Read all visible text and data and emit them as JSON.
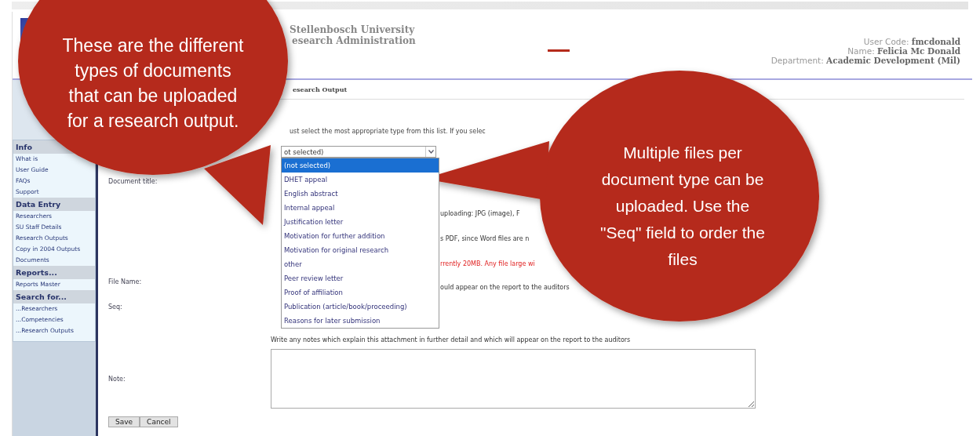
{
  "header": {
    "title": "Stellenbosch University",
    "subtitle": "esearch Administration",
    "user": [
      {
        "label": "User Code:",
        "value": "fmcdonald"
      },
      {
        "label": "Name:",
        "value": "Felicia Mc Donald"
      },
      {
        "label": "Department:",
        "value": "Academic Development (Mil)"
      }
    ]
  },
  "breadcrumb": "esearch Output",
  "sidebar": [
    {
      "title": "Info",
      "items": [
        "What is",
        "User Guide",
        "FAQs",
        "Support"
      ]
    },
    {
      "title": "Data Entry",
      "items": [
        "Researchers",
        "SU Staff Details",
        "Research Outputs",
        "Copy in 2004 Outputs",
        "Documents"
      ]
    },
    {
      "title": "Reports...",
      "items": [
        "Reports Master"
      ]
    },
    {
      "title": "Search for...",
      "items": [
        "...Researchers",
        "...Competencies",
        "...Research Outputs"
      ]
    }
  ],
  "form": {
    "instruction": "ust select the most appropriate type from this list. If you selec",
    "document_type": {
      "value": "ot selected)",
      "expanded": true,
      "options": [
        {
          "label": "(not selected)",
          "selected": true
        },
        {
          "label": "DHET appeal",
          "selected": false
        },
        {
          "label": "English abstract",
          "selected": false
        },
        {
          "label": "Internal appeal",
          "selected": false
        },
        {
          "label": "Justification letter",
          "selected": false
        },
        {
          "label": "Motivation for further addition",
          "selected": false
        },
        {
          "label": "Motivation for original research",
          "selected": false
        },
        {
          "label": "other",
          "selected": false
        },
        {
          "label": "Peer review letter",
          "selected": false
        },
        {
          "label": "Proof of affiliation",
          "selected": false
        },
        {
          "label": "Publication (article/book/proceeding)",
          "selected": false
        },
        {
          "label": "Reasons for later submission",
          "selected": false
        }
      ]
    },
    "document_title": {
      "label": "Document title:",
      "hints": [
        "uploading: JPG (image), F",
        "s PDF, since Word files are n"
      ],
      "warning": "rrently 20MB. Any file large wi"
    },
    "file_name": {
      "label": "File Name:",
      "hint": "ould appear on the report to the auditors"
    },
    "seq": {
      "label": "Seq:"
    },
    "note": {
      "label": "Note:",
      "hint": "Write any notes which explain this attachment in further detail and which will appear on the report to the auditors"
    },
    "buttons": [
      "Save",
      "Cancel"
    ]
  },
  "callouts": [
    {
      "lines": [
        "These are the different",
        "types of documents",
        "that can be uploaded",
        "for a research output."
      ]
    },
    {
      "lines": [
        "Multiple files per",
        "document type can be",
        "uploaded. Use the",
        "\"Seq\" field to order the",
        "files"
      ]
    }
  ]
}
